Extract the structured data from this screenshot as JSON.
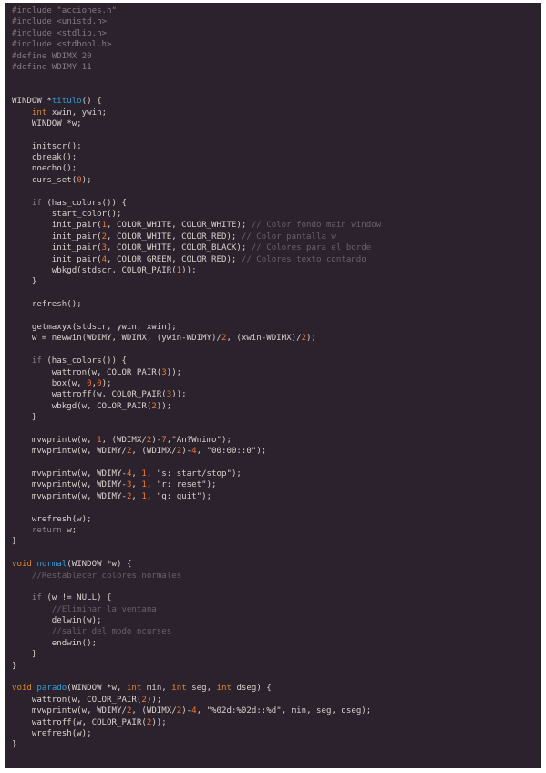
{
  "document": {
    "language": "C",
    "lines": [
      [
        [
          "pre",
          "#include \"acciones.h\""
        ]
      ],
      [
        [
          "pre",
          "#include <unistd.h>"
        ]
      ],
      [
        [
          "pre",
          "#include <stdlib.h>"
        ]
      ],
      [
        [
          "pre",
          "#include <stdbool.h>"
        ]
      ],
      [
        [
          "pre",
          "#define WDIMX 20"
        ]
      ],
      [
        [
          "pre",
          "#define WDIMY 11"
        ]
      ],
      [],
      [],
      [
        [
          "txt",
          "WINDOW *"
        ],
        [
          "fn",
          "titulo"
        ],
        [
          "txt",
          "() {"
        ]
      ],
      [
        [
          "txt",
          "    "
        ],
        [
          "type",
          "int"
        ],
        [
          "txt",
          " xwin, ywin;"
        ]
      ],
      [
        [
          "txt",
          "    WINDOW *w;"
        ]
      ],
      [],
      [
        [
          "txt",
          "    initscr();"
        ]
      ],
      [
        [
          "txt",
          "    cbreak();"
        ]
      ],
      [
        [
          "txt",
          "    noecho();"
        ]
      ],
      [
        [
          "txt",
          "    curs_set("
        ],
        [
          "num",
          "0"
        ],
        [
          "txt",
          ");"
        ]
      ],
      [],
      [
        [
          "txt",
          "    "
        ],
        [
          "ctl",
          "if"
        ],
        [
          "txt",
          " (has_colors()) {"
        ]
      ],
      [
        [
          "txt",
          "        start_color();"
        ]
      ],
      [
        [
          "txt",
          "        init_pair("
        ],
        [
          "num",
          "1"
        ],
        [
          "txt",
          ", COLOR_WHITE, COLOR_WHITE); "
        ],
        [
          "com",
          "// Color fondo main window"
        ]
      ],
      [
        [
          "txt",
          "        init_pair("
        ],
        [
          "num",
          "2"
        ],
        [
          "txt",
          ", COLOR_WHITE, COLOR_RED); "
        ],
        [
          "com",
          "// Color pantalla w"
        ]
      ],
      [
        [
          "txt",
          "        init_pair("
        ],
        [
          "num",
          "3"
        ],
        [
          "txt",
          ", COLOR_WHITE, COLOR_BLACK); "
        ],
        [
          "com",
          "// Colores para el borde"
        ]
      ],
      [
        [
          "txt",
          "        init_pair("
        ],
        [
          "num",
          "4"
        ],
        [
          "txt",
          ", COLOR_GREEN, COLOR_RED); "
        ],
        [
          "com",
          "// Colores texto contando"
        ]
      ],
      [
        [
          "txt",
          "        wbkgd(stdscr, COLOR_PAIR("
        ],
        [
          "num",
          "1"
        ],
        [
          "txt",
          "));"
        ]
      ],
      [
        [
          "txt",
          "    }"
        ]
      ],
      [],
      [
        [
          "txt",
          "    refresh();"
        ]
      ],
      [],
      [
        [
          "txt",
          "    getmaxyx(stdscr, ywin, xwin);"
        ]
      ],
      [
        [
          "txt",
          "    w = newwin(WDIMY, WDIMX, (ywin-WDIMY)/"
        ],
        [
          "num",
          "2"
        ],
        [
          "txt",
          ", (xwin-WDIMX)/"
        ],
        [
          "num",
          "2"
        ],
        [
          "txt",
          ");"
        ]
      ],
      [],
      [
        [
          "txt",
          "    "
        ],
        [
          "ctl",
          "if"
        ],
        [
          "txt",
          " (has_colors()) {"
        ]
      ],
      [
        [
          "txt",
          "        wattron(w, COLOR_PAIR("
        ],
        [
          "num",
          "3"
        ],
        [
          "txt",
          "));"
        ]
      ],
      [
        [
          "txt",
          "        box(w, "
        ],
        [
          "num",
          "0"
        ],
        [
          "txt",
          ","
        ],
        [
          "num",
          "0"
        ],
        [
          "txt",
          ");"
        ]
      ],
      [
        [
          "txt",
          "        wattroff(w, COLOR_PAIR("
        ],
        [
          "num",
          "3"
        ],
        [
          "txt",
          "));"
        ]
      ],
      [
        [
          "txt",
          "        wbkgd(w, COLOR_PAIR("
        ],
        [
          "num",
          "2"
        ],
        [
          "txt",
          "));"
        ]
      ],
      [
        [
          "txt",
          "    }"
        ]
      ],
      [],
      [
        [
          "txt",
          "    mvwprintw(w, "
        ],
        [
          "num",
          "1"
        ],
        [
          "txt",
          ", (WDIMX/"
        ],
        [
          "num",
          "2"
        ],
        [
          "txt",
          ")-"
        ],
        [
          "num",
          "7"
        ],
        [
          "txt",
          ","
        ],
        [
          "str",
          "\"An?Wnimo\""
        ],
        [
          "txt",
          ");"
        ]
      ],
      [
        [
          "txt",
          "    mvwprintw(w, WDIMY/"
        ],
        [
          "num",
          "2"
        ],
        [
          "txt",
          ", (WDIMX/"
        ],
        [
          "num",
          "2"
        ],
        [
          "txt",
          ")-"
        ],
        [
          "num",
          "4"
        ],
        [
          "txt",
          ", "
        ],
        [
          "str",
          "\"00:00::0\""
        ],
        [
          "txt",
          ");"
        ]
      ],
      [],
      [
        [
          "txt",
          "    mvwprintw(w, WDIMY-"
        ],
        [
          "num",
          "4"
        ],
        [
          "txt",
          ", "
        ],
        [
          "num",
          "1"
        ],
        [
          "txt",
          ", "
        ],
        [
          "str",
          "\"s: start/stop\""
        ],
        [
          "txt",
          ");"
        ]
      ],
      [
        [
          "txt",
          "    mvwprintw(w, WDIMY-"
        ],
        [
          "num",
          "3"
        ],
        [
          "txt",
          ", "
        ],
        [
          "num",
          "1"
        ],
        [
          "txt",
          ", "
        ],
        [
          "str",
          "\"r: reset\""
        ],
        [
          "txt",
          ");"
        ]
      ],
      [
        [
          "txt",
          "    mvwprintw(w, WDIMY-"
        ],
        [
          "num",
          "2"
        ],
        [
          "txt",
          ", "
        ],
        [
          "num",
          "1"
        ],
        [
          "txt",
          ", "
        ],
        [
          "str",
          "\"q: quit\""
        ],
        [
          "txt",
          ");"
        ]
      ],
      [],
      [
        [
          "txt",
          "    wrefresh(w);"
        ]
      ],
      [
        [
          "txt",
          "    "
        ],
        [
          "ctl",
          "return"
        ],
        [
          "txt",
          " w;"
        ]
      ],
      [
        [
          "txt",
          "}"
        ]
      ],
      [],
      [
        [
          "type",
          "void"
        ],
        [
          "txt",
          " "
        ],
        [
          "fn",
          "normal"
        ],
        [
          "txt",
          "(WINDOW *w) {"
        ]
      ],
      [
        [
          "txt",
          "    "
        ],
        [
          "com",
          "//Restablecer colores normales"
        ]
      ],
      [],
      [
        [
          "txt",
          "    "
        ],
        [
          "ctl",
          "if"
        ],
        [
          "txt",
          " (w != NULL) {"
        ]
      ],
      [
        [
          "txt",
          "        "
        ],
        [
          "com",
          "//Eliminar la ventana"
        ]
      ],
      [
        [
          "txt",
          "        delwin(w);"
        ]
      ],
      [
        [
          "txt",
          "        "
        ],
        [
          "com",
          "//salir del modo ncurses"
        ]
      ],
      [
        [
          "txt",
          "        endwin();"
        ]
      ],
      [
        [
          "txt",
          "    }"
        ]
      ],
      [
        [
          "txt",
          "}"
        ]
      ],
      [],
      [
        [
          "type",
          "void"
        ],
        [
          "txt",
          " "
        ],
        [
          "fn",
          "parado"
        ],
        [
          "txt",
          "(WINDOW *w, "
        ],
        [
          "type",
          "int"
        ],
        [
          "txt",
          " min, "
        ],
        [
          "type",
          "int"
        ],
        [
          "txt",
          " seg, "
        ],
        [
          "type",
          "int"
        ],
        [
          "txt",
          " dseg) {"
        ]
      ],
      [
        [
          "txt",
          "    wattron(w, COLOR_PAIR("
        ],
        [
          "num",
          "2"
        ],
        [
          "txt",
          "));"
        ]
      ],
      [
        [
          "txt",
          "    mvwprintw(w, WDIMY/"
        ],
        [
          "num",
          "2"
        ],
        [
          "txt",
          ", (WDIMX/"
        ],
        [
          "num",
          "2"
        ],
        [
          "txt",
          ")-"
        ],
        [
          "num",
          "4"
        ],
        [
          "txt",
          ", "
        ],
        [
          "str",
          "\"%02d:%02d::%d\""
        ],
        [
          "txt",
          ", min, seg, dseg);"
        ]
      ],
      [
        [
          "txt",
          "    wattroff(w, COLOR_PAIR("
        ],
        [
          "num",
          "2"
        ],
        [
          "txt",
          "));"
        ]
      ],
      [
        [
          "txt",
          "    wrefresh(w);"
        ]
      ],
      [
        [
          "txt",
          "}"
        ]
      ]
    ]
  },
  "colors": {
    "background": "#2b222d",
    "text": "#d8d2cc",
    "preprocessor": "#857a82",
    "keyword": "#e0862f",
    "function_name": "#2f9fd6",
    "number": "#f07832",
    "comment": "#6b6068"
  }
}
